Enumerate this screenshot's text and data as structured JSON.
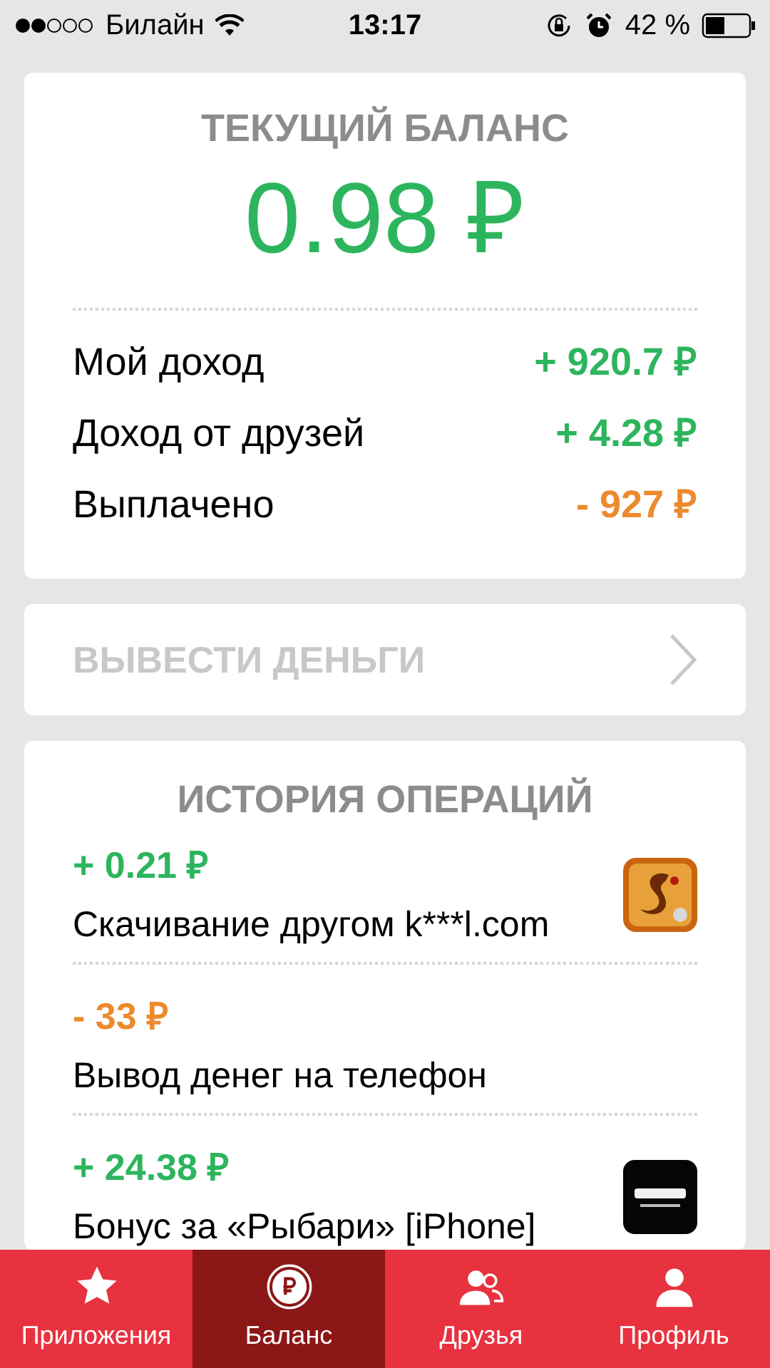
{
  "status_bar": {
    "carrier": "Билайн",
    "time": "13:17",
    "battery": "42 %"
  },
  "balance_card": {
    "title": "ТЕКУЩИЙ БАЛАНС",
    "amount": "0.98 ₽",
    "rows": [
      {
        "label": "Мой доход",
        "value": "+ 920.7 ₽",
        "kind": "income"
      },
      {
        "label": "Доход от друзей",
        "value": "+ 4.28 ₽",
        "kind": "income"
      },
      {
        "label": "Выплачено",
        "value": "- 927 ₽",
        "kind": "payout"
      }
    ]
  },
  "withdraw": {
    "label": "ВЫВЕСТИ ДЕНЬГИ",
    "disabled": true
  },
  "history": {
    "title": "ИСТОРИЯ ОПЕРАЦИЙ",
    "items": [
      {
        "amount": "+ 0.21 ₽",
        "description": "Скачивание другом k***l.com",
        "kind": "income",
        "has_picture": true
      },
      {
        "amount": "- 33 ₽",
        "description": "Вывод денег на телефон",
        "kind": "payout",
        "has_picture": false
      },
      {
        "amount": "+ 24.38 ₽",
        "description": "Бонус за «Рыбари» [iPhone]",
        "kind": "income",
        "has_picture": true
      }
    ]
  },
  "tabs": [
    {
      "label": "Приложения",
      "selected": false,
      "kind": "apps"
    },
    {
      "label": "Баланс",
      "selected": true,
      "kind": "balance"
    },
    {
      "label": "Друзья",
      "selected": false,
      "kind": "friends"
    },
    {
      "label": "Профиль",
      "selected": false,
      "kind": "profile"
    }
  ]
}
